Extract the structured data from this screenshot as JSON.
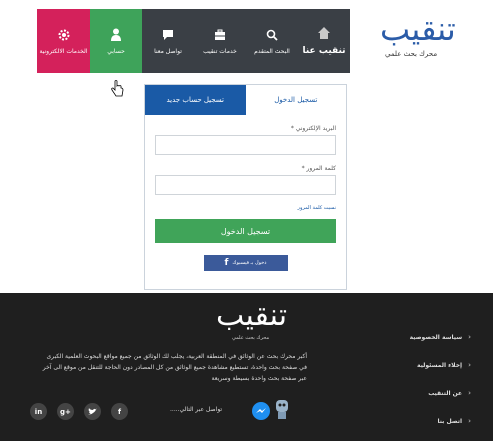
{
  "brand": {
    "logo_text": "تنقيب",
    "tagline": "محرك بحث علمي",
    "color": "#2b5ca8"
  },
  "nav": {
    "items": [
      {
        "label": "تنقيب",
        "prefix": "عنا",
        "icon": "home-icon"
      },
      {
        "label": "البحث المتقدم",
        "icon": "search-icon"
      },
      {
        "label": "خدمات تنقيب",
        "icon": "briefcase-icon"
      },
      {
        "label": "تواصل معنا",
        "icon": "chat-icon"
      },
      {
        "label": "حسابي",
        "icon": "user-icon"
      },
      {
        "label": "الخدمات الالكترونية",
        "icon": "gear-icon"
      }
    ],
    "colors": {
      "bar": "#3a3f45",
      "account": "#3ea35a",
      "eservices": "#d4215b"
    }
  },
  "login": {
    "tab_login": "تسجيل الدخول",
    "tab_register": "تسجيل حساب جديد",
    "email_label": "البريد الإلكتروني *",
    "password_label": "كلمة المرور *",
    "forgot": "نسيت كلمة المرور",
    "submit": "تسجيل الدخول",
    "facebook": "دخول بـ فيسبوك"
  },
  "footer": {
    "logo_text": "تنقيب",
    "tagline": "محرك بحث علمي",
    "description": "أكبر محرك بحث عن الوثائق في المنطقة العربية، يجلب لك الوثائق من جميع مواقع البحوث العلمية الكبرى في صفحة بحث واحدة، تستطيع مشاهدة جميع الوثائق من كل المصادر دون الحاجة للتنقل من موقع الى آخر عبر صفحة بحث واحدة بسيطة وسريعة",
    "links": [
      "سياسة الخصوصية",
      "إخلاء المسئولية",
      "عن التنقيب",
      "اتصل بنا"
    ],
    "contact_via": "تواصل عبر التالي.....",
    "social": [
      "in",
      "g+",
      "t",
      "f"
    ]
  }
}
